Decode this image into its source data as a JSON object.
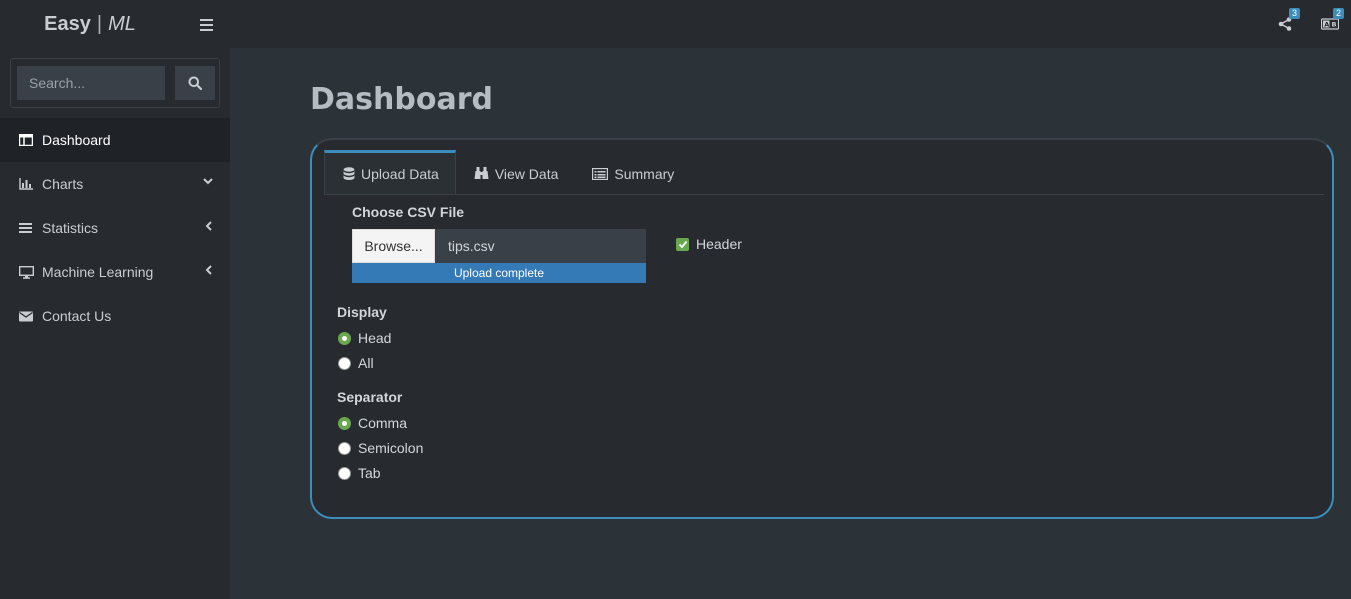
{
  "brand": {
    "easy": "Easy",
    "sep": "|",
    "ml": "ML"
  },
  "topbar": {
    "share_badge": "3",
    "translate_badge": "2"
  },
  "search": {
    "placeholder": "Search..."
  },
  "sidebar": {
    "items": [
      {
        "label": "Dashboard",
        "icon": "dashboard-icon",
        "active": true
      },
      {
        "label": "Charts",
        "icon": "bar-chart-icon",
        "chevron": "down"
      },
      {
        "label": "Statistics",
        "icon": "list-icon",
        "chevron": "left"
      },
      {
        "label": "Machine Learning",
        "icon": "desktop-icon",
        "chevron": "left"
      },
      {
        "label": "Contact Us",
        "icon": "envelope-icon"
      }
    ]
  },
  "page": {
    "title": "Dashboard"
  },
  "tabs": [
    {
      "label": "Upload Data",
      "icon": "database-icon",
      "active": true
    },
    {
      "label": "View Data",
      "icon": "binoculars-icon"
    },
    {
      "label": "Summary",
      "icon": "table-list-icon"
    }
  ],
  "upload": {
    "label": "Choose CSV File",
    "browse_label": "Browse...",
    "file_name": "tips.csv",
    "progress_text": "Upload complete",
    "progress_fraction": 1.0,
    "header_label": "Header",
    "header_checked": true
  },
  "display": {
    "label": "Display",
    "options": [
      "Head",
      "All"
    ],
    "selected": "Head"
  },
  "separator": {
    "label": "Separator",
    "options": [
      "Comma",
      "Semicolon",
      "Tab"
    ],
    "selected": "Comma"
  },
  "colors": {
    "accent": "#3c8dbc",
    "progress": "#337ab7",
    "check": "#6aa84f"
  }
}
